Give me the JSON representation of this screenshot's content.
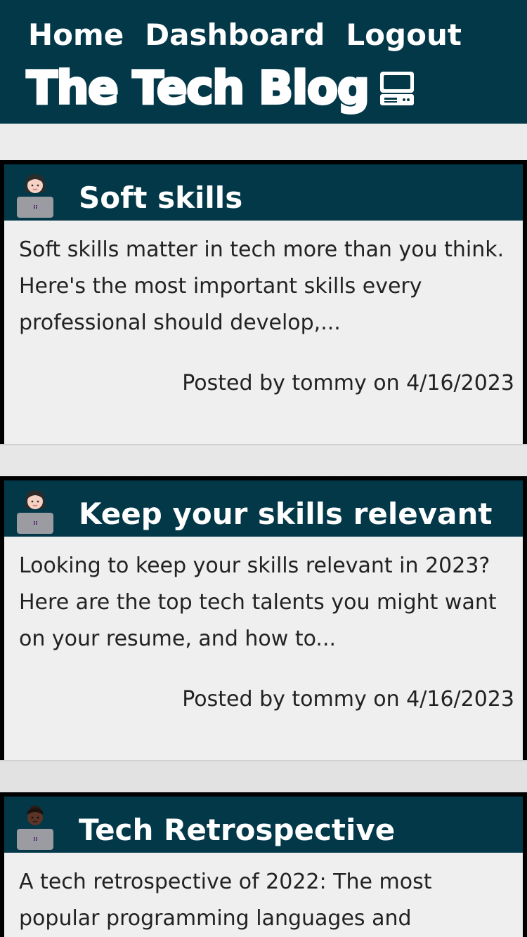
{
  "nav": {
    "home": "Home",
    "dashboard": "Dashboard",
    "logout": "Logout"
  },
  "brand": {
    "title": "The Tech Blog",
    "icon": "computer-terminal-icon"
  },
  "colors": {
    "header_bg": "#033848",
    "card_bg": "#efefef",
    "text": "#222222"
  },
  "posts": [
    {
      "title": "Soft skills",
      "excerpt": "Soft skills matter in tech more than you think. Here's the most important skills every professional should develop,...",
      "meta": "Posted by tommy on 4/16/2023",
      "avatar": "woman-technologist-light-skin-icon"
    },
    {
      "title": "Keep your skills relevant",
      "excerpt": "Looking to keep your skills relevant in 2023? Here are the top tech talents you might want on your resume, and how to...",
      "meta": "Posted by tommy on 4/16/2023",
      "avatar": "woman-technologist-light-skin-icon"
    },
    {
      "title": "Tech Retrospective",
      "excerpt": "A tech retrospective of 2022: The most popular programming languages and",
      "meta": "",
      "avatar": "technologist-dark-skin-icon"
    }
  ]
}
